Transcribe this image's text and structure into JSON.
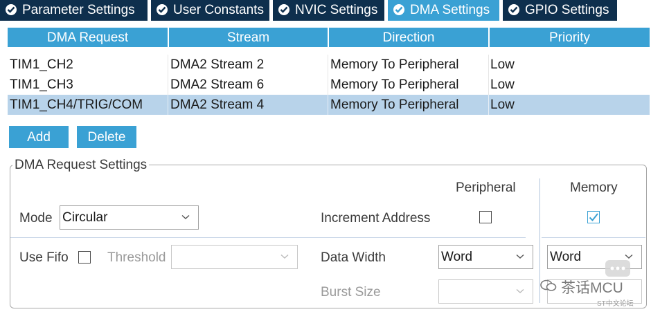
{
  "tabs": [
    {
      "label": "Parameter Settings",
      "active": false
    },
    {
      "label": "User Constants",
      "active": false
    },
    {
      "label": "NVIC Settings",
      "active": false
    },
    {
      "label": "DMA Settings",
      "active": true
    },
    {
      "label": "GPIO Settings",
      "active": false
    }
  ],
  "table": {
    "headers": [
      "DMA Request",
      "Stream",
      "Direction",
      "Priority"
    ],
    "rows": [
      [
        "TIM1_CH2",
        "DMA2 Stream 2",
        "Memory To Peripheral",
        "Low"
      ],
      [
        "TIM1_CH3",
        "DMA2 Stream 6",
        "Memory To Peripheral",
        "Low"
      ],
      [
        "TIM1_CH4/TRIG/COM",
        "DMA2 Stream 4",
        "Memory To Peripheral",
        "Low"
      ]
    ],
    "selected_row": 2
  },
  "buttons": {
    "add": "Add",
    "delete": "Delete"
  },
  "settings": {
    "title": "DMA Request Settings",
    "peripheral_col": "Peripheral",
    "memory_col": "Memory",
    "mode_label": "Mode",
    "mode_value": "Circular",
    "increment_label": "Increment Address",
    "increment_peripheral": false,
    "increment_memory": true,
    "use_fifo_label": "Use Fifo",
    "use_fifo_checked": false,
    "threshold_label": "Threshold",
    "threshold_value": "",
    "data_width_label": "Data Width",
    "data_width_peripheral": "Word",
    "data_width_memory": "Word",
    "burst_size_label": "Burst Size",
    "burst_peripheral": "",
    "burst_memory": ""
  },
  "watermark": {
    "text": "茶话MCU",
    "subtext": "ST中文论坛"
  },
  "colors": {
    "tab_bg": "#0e2f4d",
    "accent": "#3aa1d4",
    "selected_row": "#b8d3ea"
  }
}
